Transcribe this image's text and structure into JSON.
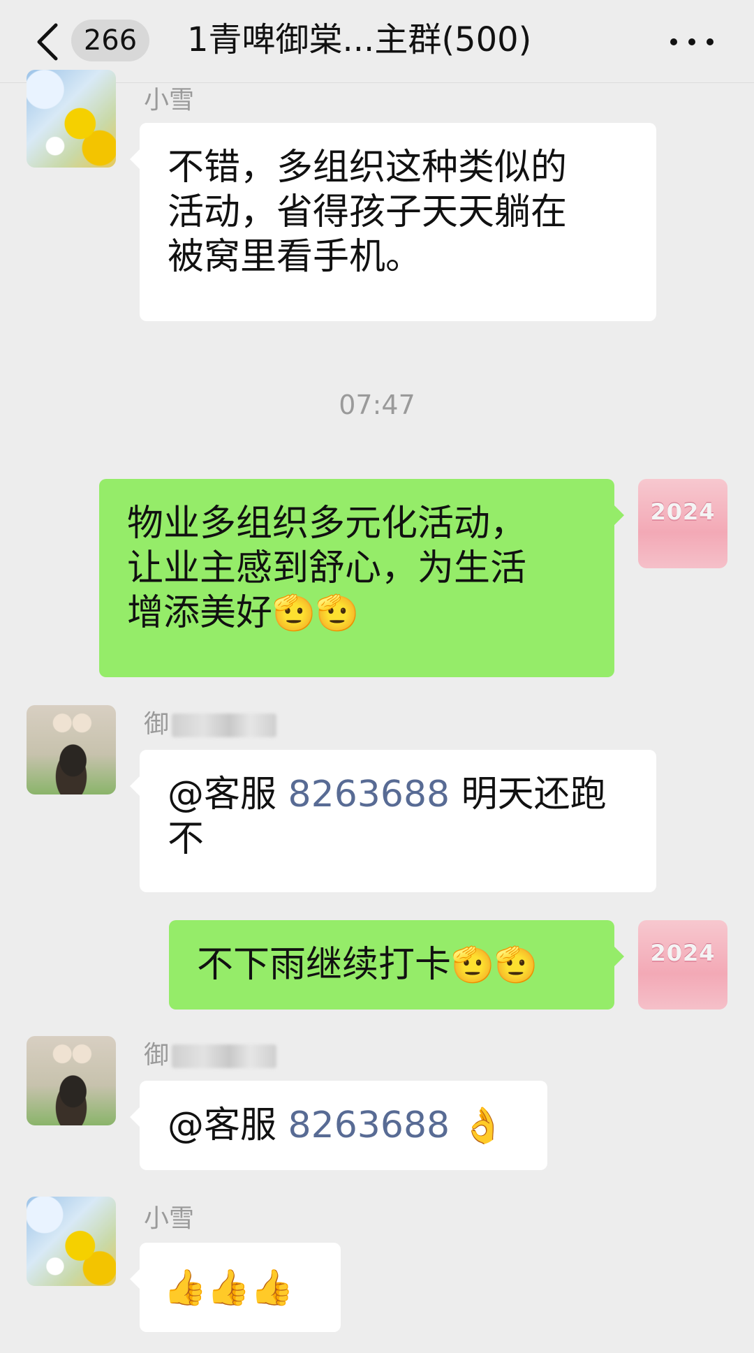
{
  "header": {
    "unread_count": "266",
    "title": "1青啤御棠...主群(500)"
  },
  "timestamp": "07:47",
  "messages": [
    {
      "sender": "小雪",
      "lines": [
        "不错，多组织这种类似的",
        "活动，省得孩子天天躺在",
        "被窝里看手机。"
      ]
    },
    {
      "sender": "me",
      "lines": [
        "物业多组织多元化活动，",
        "让业主感到舒心，为生活",
        "增添美好"
      ],
      "emoji": "🫡🫡"
    },
    {
      "sender_prefix": "御",
      "mention": "@客服",
      "mention_number": "8263688",
      "text_after": "明天还跑",
      "line2": "不"
    },
    {
      "sender": "me",
      "text": "不下雨继续打卡",
      "emoji": "🫡🫡"
    },
    {
      "sender_prefix": "御",
      "mention": "@客服",
      "mention_number": "8263688",
      "emoji": "👌"
    },
    {
      "sender": "小雪",
      "emoji": "👍👍👍"
    }
  ],
  "my_avatar_text": "2024",
  "colors": {
    "background": "#ededed",
    "outgoing_bubble": "#95ec69",
    "incoming_bubble": "#ffffff",
    "mention": "#586b94"
  }
}
